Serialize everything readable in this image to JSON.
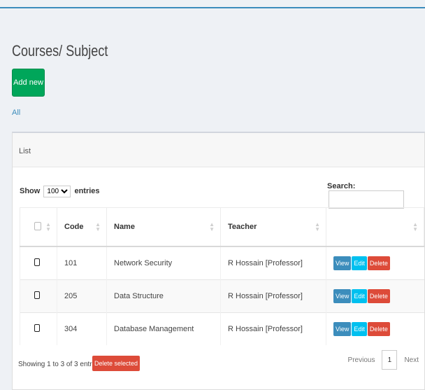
{
  "page": {
    "title": "Courses/ Subject",
    "add_label": "Add new",
    "filter_all": "All"
  },
  "box": {
    "title": "List"
  },
  "controls": {
    "show_label": "Show",
    "length_value": "100",
    "entries_label": "entries",
    "search_label": "Search:",
    "search_value": ""
  },
  "table": {
    "headers": {
      "code": "Code",
      "name": "Name",
      "teacher": "Teacher"
    },
    "rows": [
      {
        "code": "101",
        "name": "Network Security",
        "teacher": "R Hossain [Professor]"
      },
      {
        "code": "205",
        "name": "Data Structure",
        "teacher": "R Hossain [Professor]"
      },
      {
        "code": "304",
        "name": "Database Management",
        "teacher": "R Hossain [Professor]"
      }
    ],
    "actions": {
      "view": "View",
      "edit": "Edit",
      "delete": "Delete"
    }
  },
  "footer": {
    "info": "Showing 1 to 3 of 3 entries",
    "delete_selected": "Delete selected",
    "previous": "Previous",
    "page": "1",
    "next": "Next"
  },
  "colors": {
    "accent": "#3c8dbc",
    "success": "#00a65a",
    "info": "#00c0ef",
    "danger": "#dd4b39"
  },
  "icons": {
    "sort": "sort-both-icon",
    "checkbox": "checkbox-icon"
  }
}
